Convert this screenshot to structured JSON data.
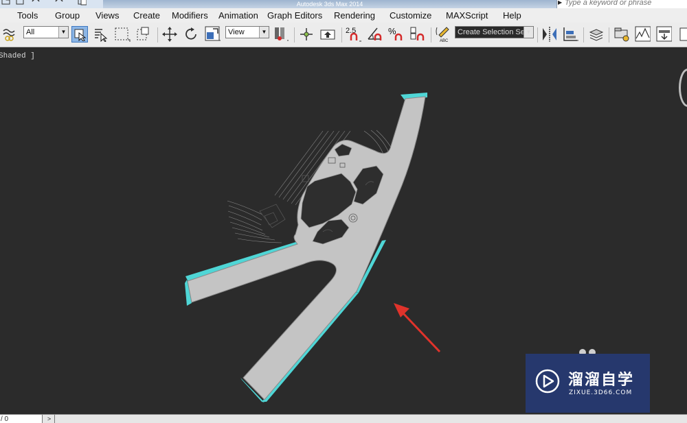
{
  "window": {
    "title": "Autodesk 3ds Max 2014",
    "search_placeholder": "Type a keyword or phrase"
  },
  "menu": [
    "Tools",
    "Group",
    "Views",
    "Create",
    "Modifiers",
    "Animation",
    "Graph Editors",
    "Rendering",
    "Customize",
    "MAXScript",
    "Help"
  ],
  "toolbar": {
    "selection_filter": "All",
    "reference_coordinate": "View",
    "snap_angle_label": "2.5",
    "snap_percent_label": "%",
    "named_selection_placeholder": "Create Selection Se",
    "icons": [
      "link-icon",
      "select-object-icon",
      "select-by-name-icon",
      "rectangular-selection-icon",
      "window-crossing-icon",
      "move-icon",
      "rotate-icon",
      "scale-icon",
      "pivot-icon",
      "manipulate-icon",
      "keyboard-shortcut-icon",
      "snaps-toggle-icon",
      "angle-snap-icon",
      "percent-snap-icon",
      "spinner-snap-icon",
      "edit-named-selection-icon",
      "mirror-icon",
      "align-icon",
      "layer-manager-icon",
      "scene-explorer-icon",
      "curve-editor-icon",
      "schematic-view-icon"
    ]
  },
  "viewport": {
    "label": "Shaded ]",
    "colors": {
      "background": "#2b2b2b",
      "road_fill": "#c4c4c4",
      "outline_highlight": "#4fd6d6",
      "building_dark": "#2e2e2e",
      "annotation_arrow": "#e0332b"
    }
  },
  "watermark": {
    "title": "溜溜自学",
    "domain": "ZIXUE.3D66.COM",
    "background": "#26386d"
  },
  "statusbar": {
    "frame_counter": "/ 0",
    "next_button": ">"
  }
}
